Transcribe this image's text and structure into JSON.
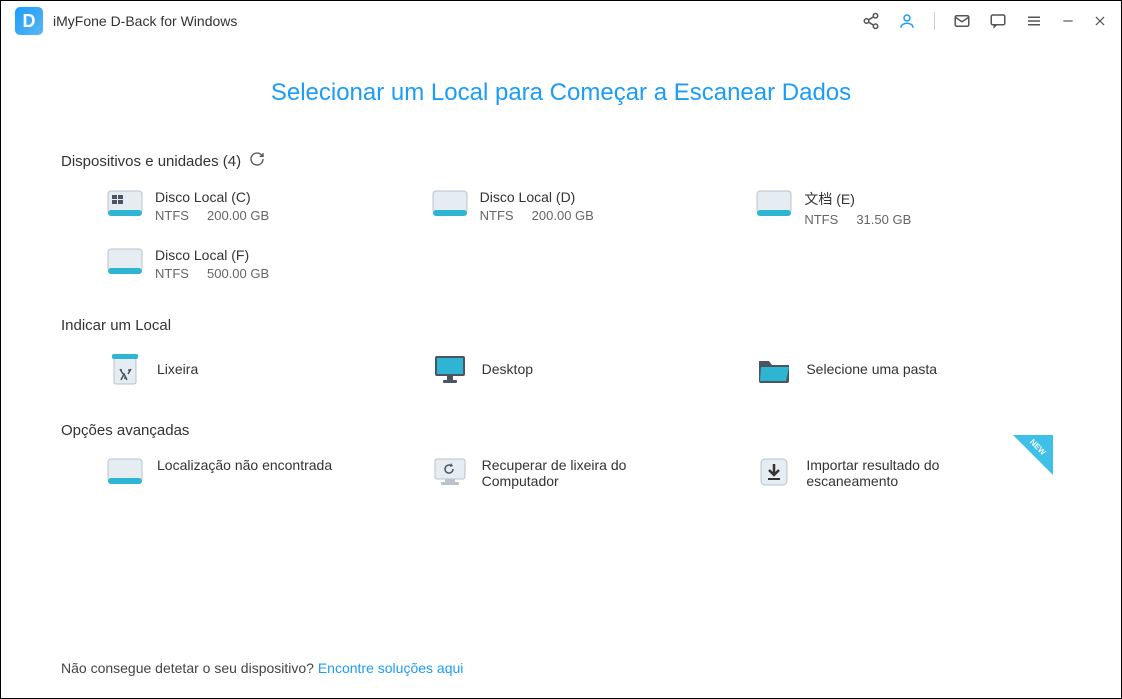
{
  "titlebar": {
    "title": "iMyFone D-Back for Windows"
  },
  "page": {
    "title": "Selecionar um Local para Começar a Escanear Dados"
  },
  "devices": {
    "heading": "Dispositivos e unidades (4)",
    "drives": [
      {
        "name": "Disco Local (C)",
        "fs": "NTFS",
        "size": "200.00 GB"
      },
      {
        "name": "Disco Local (D)",
        "fs": "NTFS",
        "size": "200.00 GB"
      },
      {
        "name": "文档 (E)",
        "fs": "NTFS",
        "size": "31.50 GB"
      },
      {
        "name": "Disco Local (F)",
        "fs": "NTFS",
        "size": "500.00 GB"
      }
    ]
  },
  "locations": {
    "heading": "Indicar um Local",
    "items": {
      "recycle": "Lixeira",
      "desktop": "Desktop",
      "folder": "Selecione uma pasta"
    }
  },
  "advanced": {
    "heading": "Opções avançadas",
    "items": {
      "lost_location": "Localização não encontrada",
      "recover_bin": "Recuperar de lixeira do Computador",
      "import_scan": "Importar resultado do escaneamento"
    },
    "new_badge": "NEW"
  },
  "footer": {
    "text": "Não consegue detetar o seu dispositivo?",
    "link": "Encontre soluções aqui"
  }
}
